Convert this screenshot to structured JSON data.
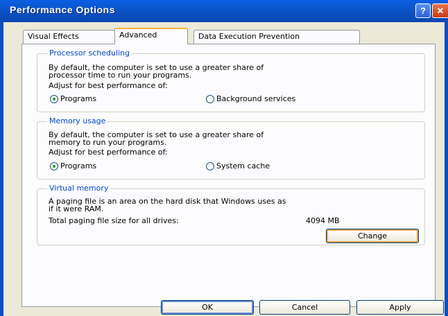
{
  "window": {
    "title": "Performance Options"
  },
  "tabs": [
    {
      "label": "Visual Effects",
      "active": false
    },
    {
      "label": "Advanced",
      "active": true
    },
    {
      "label": "Data Execution Prevention",
      "active": false
    }
  ],
  "processor": {
    "label": "Processor scheduling",
    "desc_line1": "By default, the computer is set to use a greater share of",
    "desc_line2": "processor time to run your programs.",
    "adjust": "Adjust for best performance of:",
    "option1": "Programs",
    "option2": "Background services",
    "selected": "Programs"
  },
  "memory": {
    "label": "Memory usage",
    "desc_line1": "By default, the computer is set to use a greater share of",
    "desc_line2": "memory to run your programs.",
    "adjust": "Adjust for best performance of:",
    "option1": "Programs",
    "option2": "System cache",
    "selected": "Programs"
  },
  "virtual": {
    "label": "Virtual memory",
    "desc_line1": "A paging file is an area on the hard disk that Windows uses as",
    "desc_line2": "if it were RAM.",
    "total_label": "Total paging file size for all drives:",
    "total_value": "4094 MB",
    "change": "Change"
  },
  "buttons": {
    "ok": "OK",
    "cancel": "Cancel",
    "apply": "Apply"
  },
  "colors": {
    "titlebar": "#0a4fc2",
    "group_label": "#0046d5",
    "window_bg": "#ece9d8"
  }
}
